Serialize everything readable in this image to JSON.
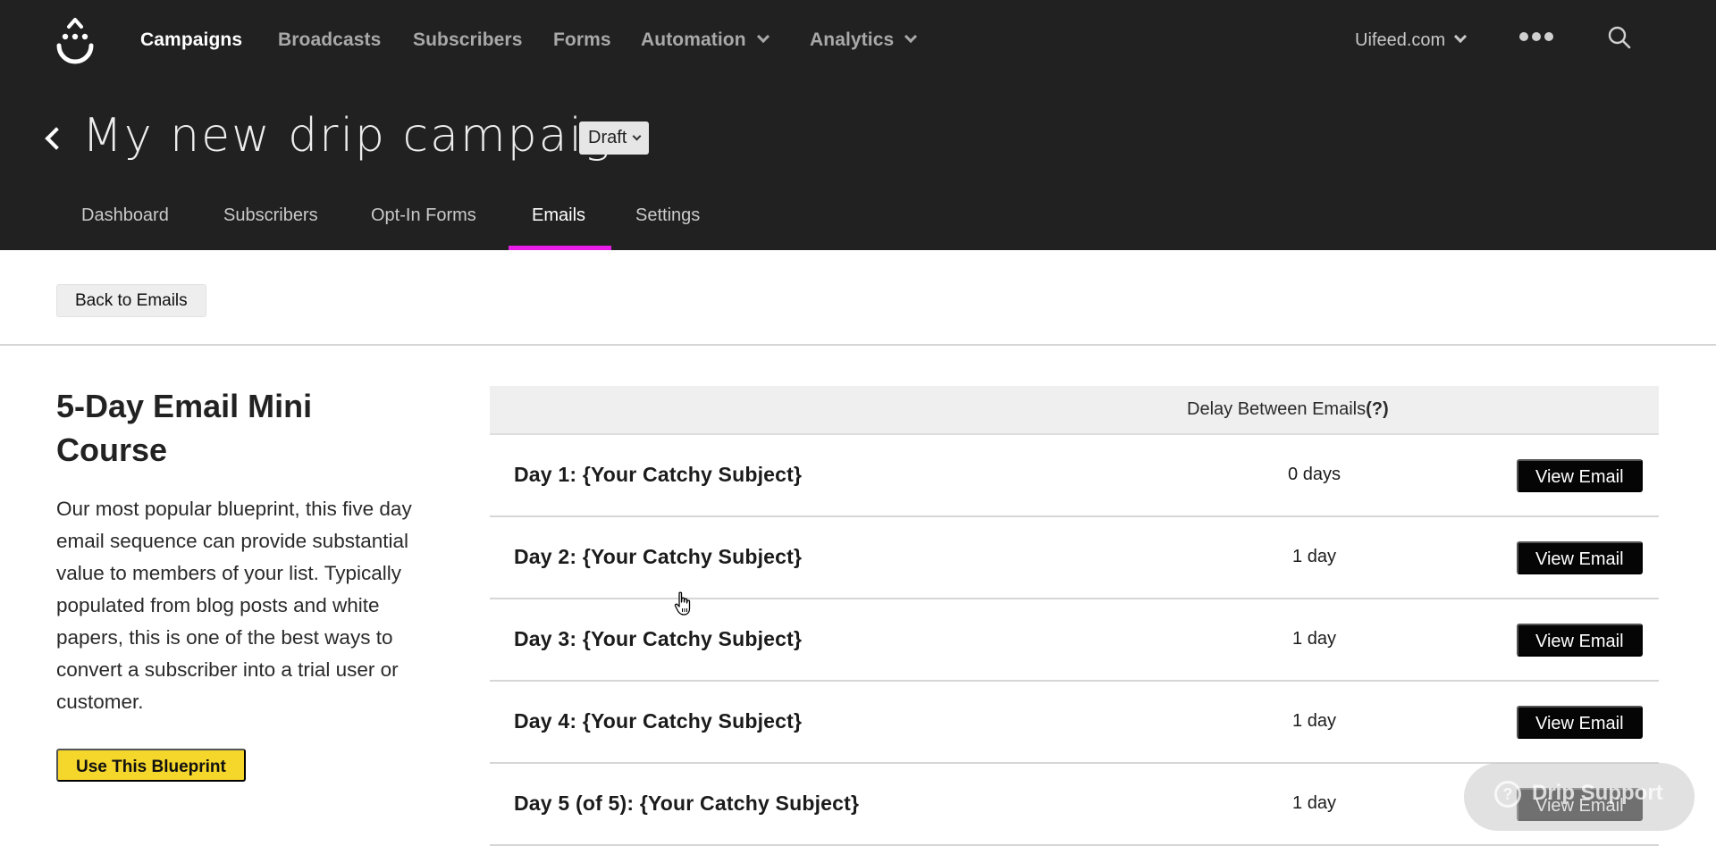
{
  "topnav": {
    "logo": "drip-logo",
    "items": [
      {
        "label": "Campaigns",
        "active": true,
        "has_dropdown": false
      },
      {
        "label": "Broadcasts",
        "active": false,
        "has_dropdown": false
      },
      {
        "label": "Subscribers",
        "active": false,
        "has_dropdown": false
      },
      {
        "label": "Forms",
        "active": false,
        "has_dropdown": false
      },
      {
        "label": "Automation",
        "active": false,
        "has_dropdown": true
      },
      {
        "label": "Analytics",
        "active": false,
        "has_dropdown": true
      }
    ],
    "account": "Uifeed.com",
    "more_icon": "ellipsis-icon",
    "search_icon": "search-icon"
  },
  "campaign": {
    "title": "My new drip campaign",
    "status": "Draft"
  },
  "tabs": [
    {
      "label": "Dashboard",
      "active": false
    },
    {
      "label": "Subscribers",
      "active": false
    },
    {
      "label": "Opt-In Forms",
      "active": false
    },
    {
      "label": "Emails",
      "active": true
    },
    {
      "label": "Settings",
      "active": false
    }
  ],
  "colors": {
    "header_bg": "#212121",
    "tab_accent": "#e81ee8",
    "blueprint_button": "#f5d62a",
    "view_button": "#050505"
  },
  "content": {
    "back_button": "Back to Emails",
    "blueprint": {
      "title": "5-Day Email Mini Course",
      "description": "Our most popular blueprint, this five day email sequence can provide substantial value to members of your list. Typically populated from blog posts and white papers, this is one of the best ways to convert a subscriber into a trial user or customer.",
      "use_button": "Use This Blueprint"
    },
    "table": {
      "header_delay": "Delay Between Emails",
      "header_help": "(?)",
      "rows": [
        {
          "subject": "Day 1: {Your Catchy Subject}",
          "delay": "0 days",
          "action": "View Email"
        },
        {
          "subject": "Day 2: {Your Catchy Subject}",
          "delay": "1 day",
          "action": "View Email"
        },
        {
          "subject": "Day 3: {Your Catchy Subject}",
          "delay": "1 day",
          "action": "View Email"
        },
        {
          "subject": "Day 4: {Your Catchy Subject}",
          "delay": "1 day",
          "action": "View Email"
        },
        {
          "subject": "Day 5 (of 5): {Your Catchy Subject}",
          "delay": "1 day",
          "action": "View Email"
        }
      ]
    }
  },
  "help_widget": {
    "label": "Drip Support",
    "icon": "?"
  }
}
